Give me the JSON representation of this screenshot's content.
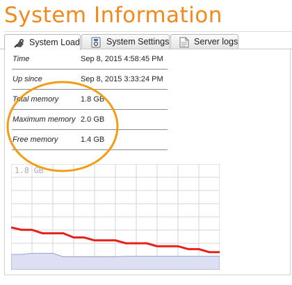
{
  "page": {
    "title": "System Information"
  },
  "tabs": [
    {
      "label": "System Load",
      "icon": "gear-load-icon",
      "active": true
    },
    {
      "label": "System Settings",
      "icon": "settings-icon",
      "active": false
    },
    {
      "label": "Server logs",
      "icon": "document-icon",
      "active": false
    }
  ],
  "info": [
    {
      "key": "Time",
      "value": "Sep 8, 2015 4:58:45 PM"
    },
    {
      "key": "Up since",
      "value": "Sep 8, 2015 3:33:24 PM"
    },
    {
      "key": "Total memory",
      "value": "1.8 GB"
    },
    {
      "key": "Maximum memory",
      "value": "2.0 GB"
    },
    {
      "key": "Free memory",
      "value": "1.4 GB"
    }
  ],
  "colors": {
    "accent": "#f08a1e",
    "series_line": "#e8201a",
    "series_area": "#dce0f2",
    "annotation": "#f39c12"
  },
  "chart_data": {
    "type": "line",
    "y_label_text": "1.8 GB",
    "ylim": [
      0,
      1.8
    ],
    "grid": true,
    "series": [
      {
        "values": [
          0.72,
          0.68,
          0.68,
          0.62,
          0.62,
          0.62,
          0.55,
          0.55,
          0.5,
          0.5,
          0.5,
          0.45,
          0.45,
          0.45,
          0.4,
          0.4,
          0.4,
          0.35,
          0.35,
          0.3,
          0.3
        ]
      },
      {
        "values": [
          0.26,
          0.26,
          0.28,
          0.28,
          0.28,
          0.22,
          0.22,
          0.22,
          0.22,
          0.22,
          0.22,
          0.23,
          0.23,
          0.23,
          0.23,
          0.23,
          0.23,
          0.23,
          0.23,
          0.23,
          0.23
        ]
      }
    ]
  }
}
